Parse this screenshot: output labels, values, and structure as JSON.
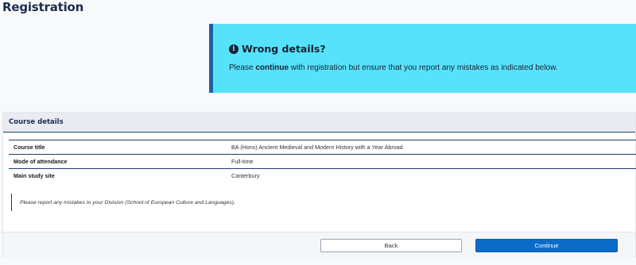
{
  "page": {
    "title": "Registration"
  },
  "alert": {
    "icon": "info-circle-icon",
    "heading": "Wrong details?",
    "text_prefix": "Please ",
    "text_bold": "continue",
    "text_suffix": " with registration but ensure that you report any mistakes as indicated below.",
    "background_color": "#56e2fb",
    "accent_color": "#1f5ea8"
  },
  "course": {
    "header": "Course details",
    "rows": [
      {
        "label": "Course title",
        "value": "BA (Hons) Ancient Medieval and Modern History with a Year Abroad"
      },
      {
        "label": "Mode of attendance",
        "value": "Full-time"
      },
      {
        "label": "Main study site",
        "value": "Canterbury"
      }
    ],
    "note": "Please report any mistakes to your Division (School of European Culture and Languages)."
  },
  "actions": {
    "back_label": "Back",
    "continue_label": "Continue",
    "continue_color": "#0b6cc8"
  }
}
